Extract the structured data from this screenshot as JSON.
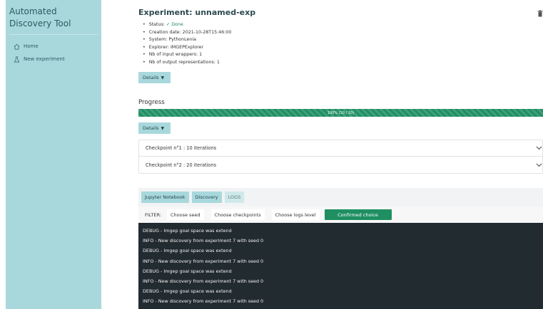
{
  "sidebar": {
    "app_title": "Automated Discovery Tool",
    "items": [
      {
        "label": "Home",
        "icon": "home-icon"
      },
      {
        "label": "New experiment",
        "icon": "flask-icon"
      }
    ]
  },
  "experiment": {
    "title": "Experiment: unnamed-exp",
    "status_label": "Status:",
    "status_value": "✓ Done",
    "creation_date": "Creation date: 2021-10-28T15:46:00",
    "system": "System: PythonLenia",
    "explorer": "Explorer: IMGEPExplorer",
    "input_wrappers": "Nb of input wrappers: 1",
    "output_representations": "Nb of output representations: 1",
    "details_label": "Details"
  },
  "progress": {
    "title": "Progress",
    "percent": 100,
    "label": "100% (10 / 10)",
    "details_label": "Details"
  },
  "checkpoints": [
    {
      "label": "Checkpoint n°1 : 10 iterations"
    },
    {
      "label": "Checkpoint n°2 : 20 iterations"
    }
  ],
  "tabs": [
    {
      "label": "Jupyter Notebook"
    },
    {
      "label": "Discovery"
    },
    {
      "label": "LOGS"
    }
  ],
  "filter": {
    "label": "FILTER:",
    "choose_seed": "Choose seed",
    "choose_checkpoints": "Choose checkpoints",
    "choose_logs_level": "Choose logs level",
    "confirmed_choice": "Confirmed choice"
  },
  "logs": [
    "DEBUG - Imgep goal space was extend",
    "INFO - New discovery from experiment 7 with seed 0",
    "DEBUG - Imgep goal space was extend",
    "INFO - New discovery from experiment 7 with seed 0",
    "DEBUG - Imgep goal space was extend",
    "INFO - New discovery from experiment 7 with seed 0",
    "DEBUG - Imgep goal space was extend",
    "INFO - New discovery from experiment 7 with seed 0"
  ],
  "colors": {
    "sidebar_bg": "#a8d8dc",
    "accent_green": "#1f8f62",
    "log_bg": "#222b30"
  }
}
